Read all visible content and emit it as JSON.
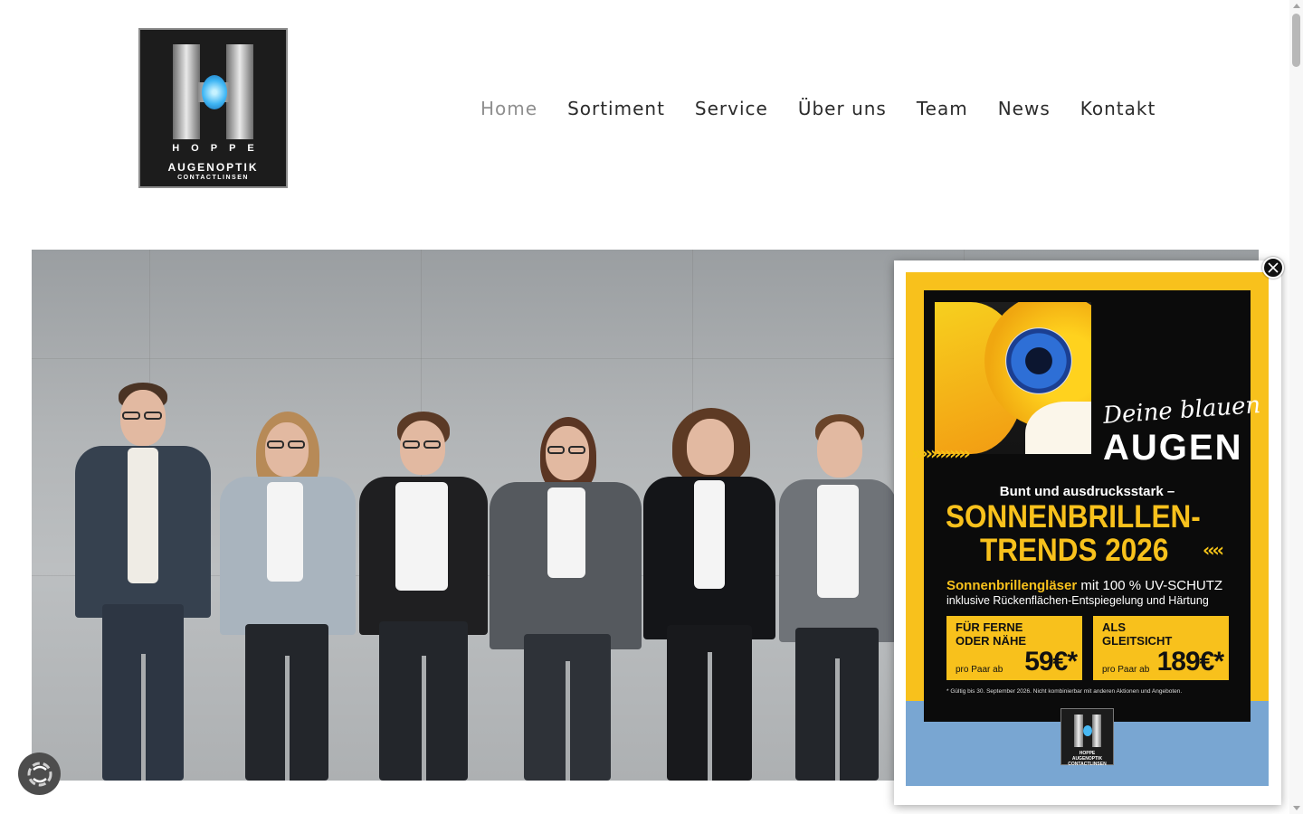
{
  "logo": {
    "line1": "HOPPE",
    "line2": "AUGENOPTIK",
    "line3": "CONTACTLINSEN"
  },
  "nav": {
    "items": [
      {
        "label": "Home",
        "active": true
      },
      {
        "label": "Sortiment",
        "active": false
      },
      {
        "label": "Service",
        "active": false
      },
      {
        "label": "Über uns",
        "active": false
      },
      {
        "label": "Team",
        "active": false
      },
      {
        "label": "News",
        "active": false
      },
      {
        "label": "Kontakt",
        "active": false
      }
    ]
  },
  "popup": {
    "script_line": "Deine blauen",
    "headline": "AUGEN",
    "chevrons_left": "››››››››››››",
    "chevrons_right": "‹‹‹‹",
    "subheadline": "Bunt und ausdrucksstark –",
    "trend_line1": "SONNENBRILLEN-",
    "trend_line2": "TRENDS 2026",
    "lens_highlight": "Sonnenbrillengläser",
    "lens_rest": " mit 100 % UV-SCHUTZ",
    "lens_line2": "inklusive Rückenflächen-Entspiegelung und Härtung",
    "offers": [
      {
        "line1": "FÜR FERNE",
        "line2": "ODER NÄHE",
        "prefix": "pro Paar ab",
        "price": "59€*"
      },
      {
        "line1": "ALS",
        "line2": "GLEITSICHT",
        "prefix": "pro Paar ab",
        "price": "189€*"
      }
    ],
    "footnote": "* Gültig bis 30. September 2026. Nicht kombinierbar mit anderen Aktionen und Angeboten.",
    "mini_logo": {
      "line1": "HOPPE",
      "line2": "AUGENOPTIK",
      "line3": "CONTACTLINSEN"
    }
  },
  "colors": {
    "ad_yellow": "#f8c11c",
    "ad_blue": "#79a6d2",
    "nav_text": "#2b2b2b",
    "nav_active": "#8f8f8f"
  },
  "icons": {
    "close": "close-icon",
    "cookie": "cookie-settings-icon"
  }
}
